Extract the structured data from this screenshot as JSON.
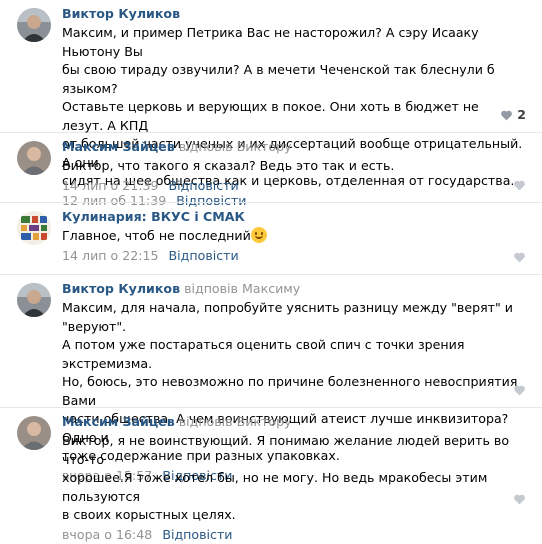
{
  "comments": [
    {
      "author": "Виктор Куликов",
      "reply_word": "",
      "reply_target": "",
      "lines": [
        "Максим, и пример Петрика Вас не насторожил? А сэру Исааку Ньютону Вы",
        "бы свою тираду озвучили? А в мечети Чеченской так блеснули б языком?",
        "Оставьте церковь и верующих в покое. Они хоть в бюджет не лезут. А КПД",
        "от большей части ученых и их диссертаций вообще отрицательный. А они",
        "сидят на шее общества как и церковь, отделенная от государства."
      ],
      "time": "12 лип об 11:39",
      "reply_label": "Відповісти",
      "likes": "2",
      "avatar_icon": "user-photo-icon"
    },
    {
      "author": "Максим Зайцев",
      "reply_word": "відповів",
      "reply_target": "Виктору",
      "lines": [
        "Виктор, что такого я сказал? Ведь это так и есть."
      ],
      "time": "14 лип о 21:39",
      "reply_label": "Відповісти",
      "likes": "",
      "avatar_icon": "user-photo-icon"
    },
    {
      "author": "Кулинария: ВКУС і СМАК",
      "reply_word": "",
      "reply_target": "",
      "lines": [
        "Главное, чтоб не последний"
      ],
      "emoji_icon": "smiling-face-icon",
      "time": "14 лип о 22:15",
      "reply_label": "Відповісти",
      "likes": "",
      "avatar_icon": "community-logo-icon"
    },
    {
      "author": "Виктор Куликов",
      "reply_word": "відповів",
      "reply_target": "Максиму",
      "lines": [
        "Максим, для начала, попробуйте уяснить разницу между \"верят\" и \"веруют\".",
        "А потом уже постараться оценить свой спич с точки зрения экстремизма.",
        "Но, боюсь, это невозможно по причине болезненного невосприятия Вами",
        "части общества. А чем воинствующий атеист лучше инквизитора? Одно и",
        "тоже содержание при разных упаковках."
      ],
      "time": "вчора о 15:57",
      "reply_label": "Відповісти",
      "likes": "",
      "avatar_icon": "user-photo-icon"
    },
    {
      "author": "Максим Зайцев",
      "reply_word": "відповів",
      "reply_target": "Виктору",
      "lines": [
        "Виктор, я не воинствующий. Я понимаю желание людей верить во что-то",
        "хорошее.Я тоже хотел бы, но не могу. Но ведь мракобесы этим пользуются",
        "в своих корыстных целях."
      ],
      "time": "вчора о 16:48",
      "reply_label": "Відповісти",
      "likes": "",
      "avatar_icon": "user-photo-icon"
    }
  ],
  "colors": {
    "link": "#2a5885",
    "meta": "#939393",
    "divider": "#e7e8ec",
    "heart": "#c5c9d0"
  }
}
